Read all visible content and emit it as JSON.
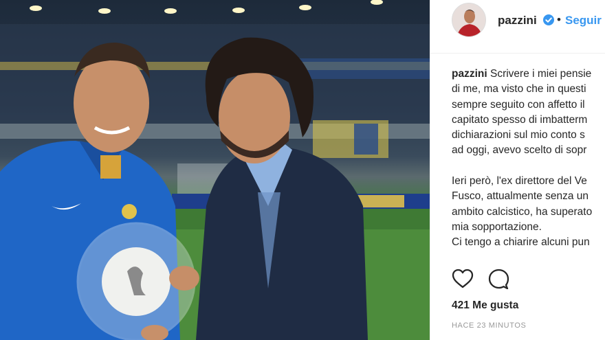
{
  "post": {
    "username": "pazzini",
    "verified": true,
    "separator": "•",
    "follow_label": "Seguir",
    "caption_username": "pazzini",
    "caption_lines": [
      "Scrivere i miei pensie",
      "di me, ma visto che in questi",
      "sempre seguito con affetto il",
      "capitato spesso di imbatterm",
      "dichiarazioni sul mio conto s",
      "ad oggi, avevo scelto di sopr",
      "",
      "Ieri però, l'ex direttore del Ve",
      "Fusco, attualmente senza un",
      "ambito calcistico, ha superato",
      "mia sopportazione.",
      "Ci tengo a chiarire alcuni pun"
    ],
    "likes": "421 Me gusta",
    "timestamp": "HACE 23 MINUTOS"
  },
  "icons": {
    "like": "heart-icon",
    "comment": "comment-icon",
    "verified": "verified-badge-icon"
  },
  "colors": {
    "link": "#3897f0",
    "text": "#262626",
    "muted": "#999999",
    "divider": "#efefef"
  }
}
